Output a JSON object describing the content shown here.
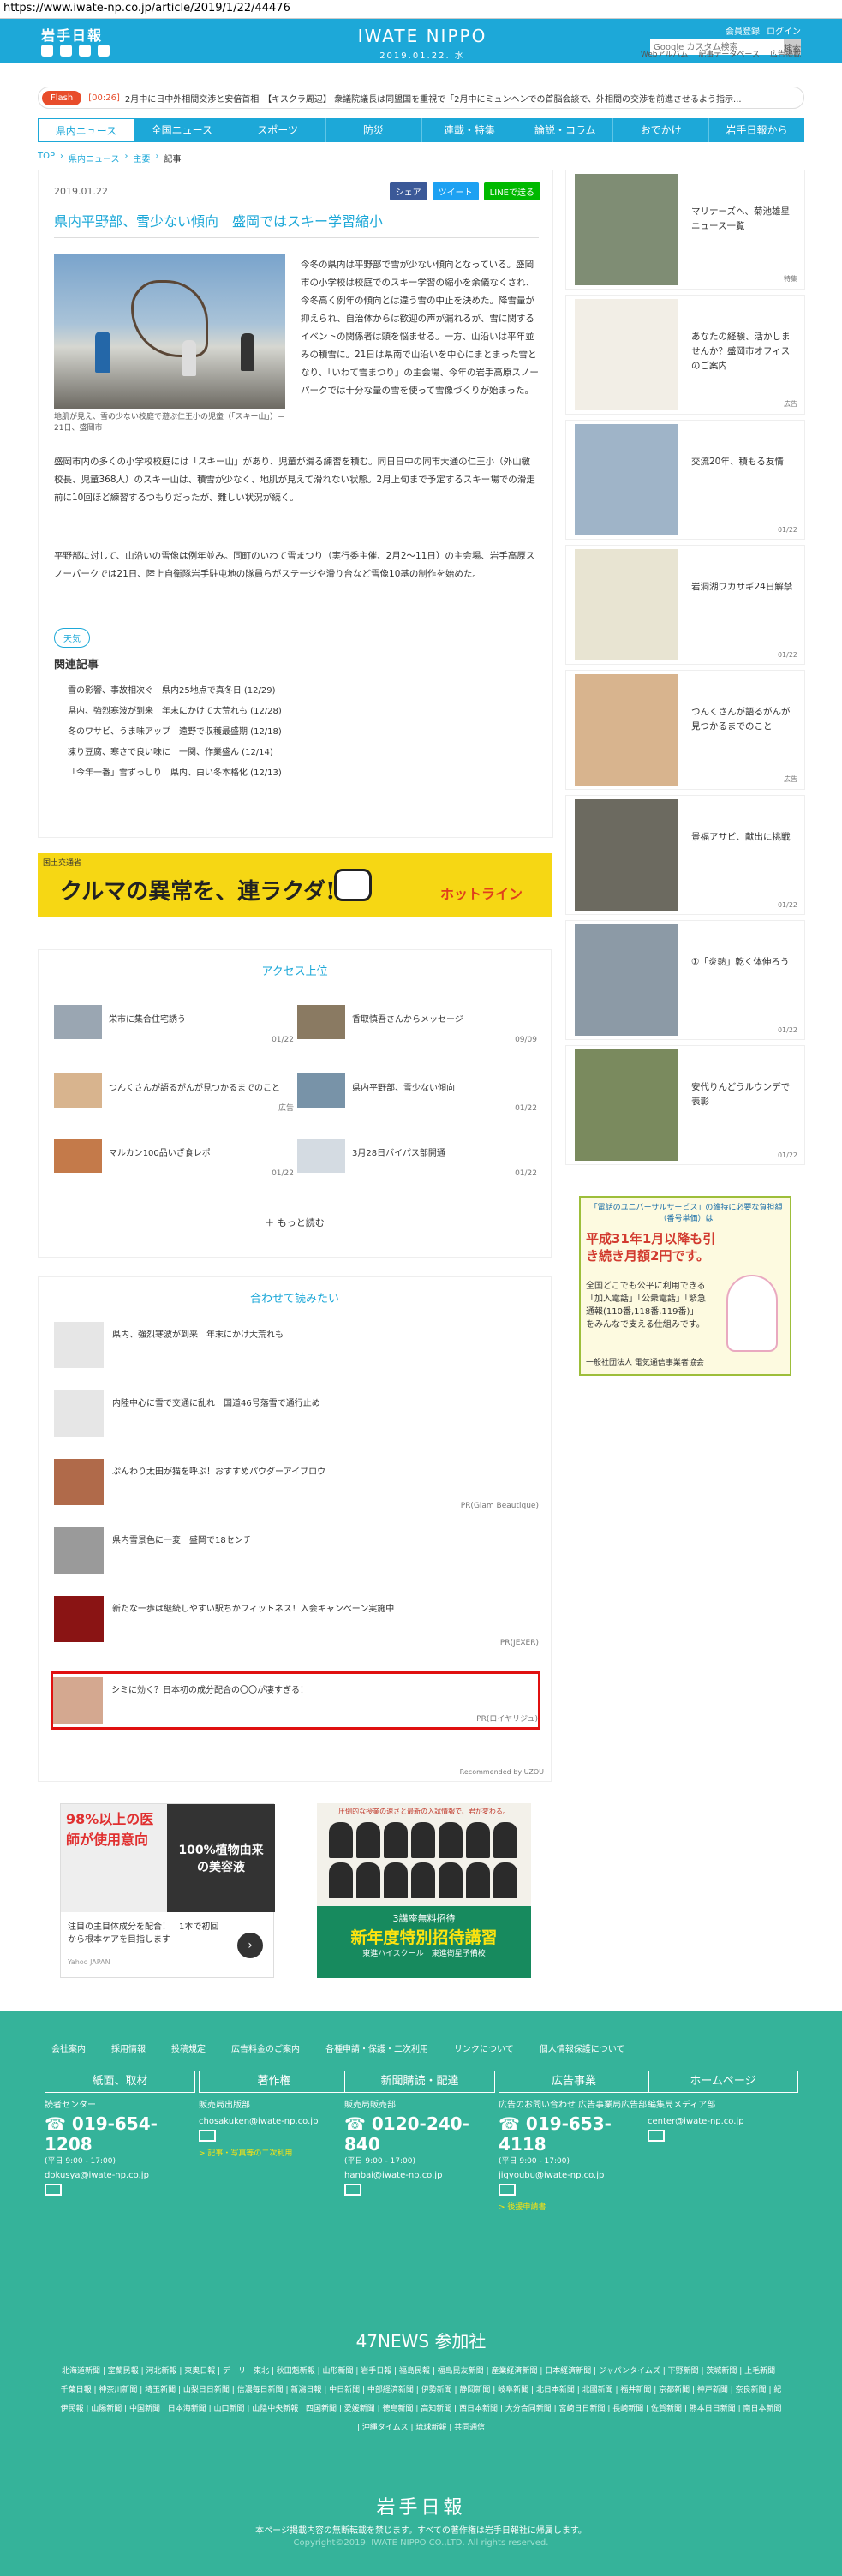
{
  "browser": {
    "url": "https://www.iwate-np.co.jp/article/2019/1/22/44476"
  },
  "header": {
    "logo_small": "岩手日報",
    "brand_name": "IWATE NIPPO",
    "brand_date": "2019.01.22. 水",
    "register": "会員登録",
    "login": "ログイン",
    "search_placeholder": "Google カスタム検索",
    "search_button": "検索",
    "subnav": [
      "Webアルバム",
      "記事データベース",
      "広告掲載"
    ]
  },
  "flash": {
    "tag": "Flash",
    "time": "[00:26]",
    "text": "2月中に日中外相間交渉と安倍首相　【キスクラ周辺】 衆議院議長は同盟国を重視で「2月中にミュンヘンでの首脳会談で、外相間の交渉を前進させるよう指示..."
  },
  "gnav": [
    "県内ニュース",
    "全国ニュース",
    "スポーツ",
    "防災",
    "連載・特集",
    "論説・コラム",
    "おでかけ",
    "岩手日報から"
  ],
  "breadcrumb": [
    "TOP",
    "県内ニュース",
    "主要",
    "記事"
  ],
  "article": {
    "date": "2019.01.22",
    "share": [
      "シェア",
      "ツイート",
      "LINEで送る"
    ],
    "title": "県内平野部、雪少ない傾向　盛岡ではスキー学習縮小",
    "caption": "地肌が見え、雪の少ない校庭で遊ぶ仁王小の児童（「スキー山」）＝21日、盛岡市",
    "p1": "今冬の県内は平野部で雪が少ない傾向となっている。盛岡市の小学校は校庭でのスキー学習の縮小を余儀なくされ、今冬高く例年の傾向とは違う雪の中止を決めた。降雪量が抑えられ、自治体からは歓迎の声が漏れるが、雪に関するイベントの関係者は頭を悩ませる。一方、山沿いは平年並みの積雪に。21日は県南で山沿いを中心にまとまった雪となり、「いわて雪まつり」の主会場、今年の岩手高原スノーパークでは十分な量の雪を使って雪像づくりが始まった。",
    "p2": "盛岡市内の多くの小学校校庭には「スキー山」があり、児童が滑る練習を積む。同日日中の同市大通の仁王小（外山敏校長、児童368人）のスキー山は、積雪が少なく、地肌が見えて滑れない状態。2月上旬まで予定するスキー場での滑走前に10回ほど練習するつもりだったが、難しい状況が続く。",
    "p3": "平野部に対して、山沿いの雪像は例年並み。同町のいわて雪まつり（実行委主催、2月2〜11日）の主会場、岩手高原スノーパークでは21日、陸上自衛隊岩手駐屯地の隊員らがステージや滑り台など雪像10基の制作を始めた。",
    "weather_tag": "天気",
    "related_heading": "関連記事",
    "related": [
      "雪の影響、事故相次ぐ　県内25地点で真冬日 (12/29)",
      "県内、強烈寒波が到来　年末にかけて大荒れも (12/28)",
      "冬のワサビ、うま味アップ　遠野で収穫最盛期 (12/18)",
      "凍り豆腐、寒さで良い味に　一関、作業盛ん (12/14)",
      "「今年一番」雪ずっしり　県内、白い冬本格化 (12/13)"
    ]
  },
  "banner_ad": {
    "small": "国土交通省",
    "main": "クルマの異常を、連ラクダ!",
    "brand": "ホットライン"
  },
  "ranking": {
    "heading": "アクセス上位",
    "items": [
      {
        "title": "栄市に集合住宅誘う",
        "date": "01/22"
      },
      {
        "title": "香取慎吾さんからメッセージ",
        "date": "09/09"
      },
      {
        "title": "つんくさんが語るがんが見つかるまでのこと",
        "date": "広告"
      },
      {
        "title": "県内平野部、雪少ない傾向",
        "date": "01/22"
      },
      {
        "title": "マルカン100品いざ食レポ",
        "date": "01/22"
      },
      {
        "title": "3月28日バイパス部開通",
        "date": "01/22"
      }
    ],
    "more": "もっと読む"
  },
  "recommend": {
    "heading": "合わせて読みたい",
    "items": [
      {
        "title": "県内、強烈寒波が到来　年末にかけ大荒れも",
        "pr": ""
      },
      {
        "title": "内陸中心に雪で交通に乱れ　国道46号落雪で通行止め",
        "pr": ""
      },
      {
        "title": "ぷんわり太田が猫を呼ぶ！おすすめパウダーアイブロウ",
        "pr": "PR(Glam Beautique)"
      },
      {
        "title": "県内雪景色に一変　盛岡で18センチ",
        "pr": ""
      },
      {
        "title": "新たな一歩は継続しやすい駅ちかフィットネス！入会キャンペーン実施中",
        "pr": "PR(JEXER)"
      },
      {
        "title": "シミに効く？日本初の成分配合の〇〇が凄すぎる！",
        "pr": "PR(ロイヤリジュ)"
      }
    ],
    "recommended_by": "Recommended by UZOU"
  },
  "ad_left": {
    "percent": "98%以上の医師が使用意向",
    "right": "100%植物由来の美容液",
    "text": "注目の主目体成分を配合！　1本で初回から根本ケアを目指します",
    "sponsor": "Yahoo JAPAN"
  },
  "ad_right": {
    "caption": "圧倒的な授業の速さと最新の入試情報で、君が変わる。",
    "line1": "3講座無料招待",
    "line2": "新年度特別招待講習",
    "line3": "東進ハイスクール　東進衛星予備校"
  },
  "sidebar": [
    {
      "title": "マリナーズへ、菊池雄星ニュース一覧",
      "date": "特集"
    },
    {
      "title": "あなたの経験、活かしませんか？盛岡市オフィスのご案内",
      "date": "広告"
    },
    {
      "title": "交流20年、積もる友情",
      "date": "01/22"
    },
    {
      "title": "岩洞湖ワカサギ24日解禁",
      "date": "01/22"
    },
    {
      "title": "つんくさんが語るがんが見つかるまでのこと",
      "date": "広告"
    },
    {
      "title": "景福アサビ、献出に挑戦",
      "date": "01/22"
    },
    {
      "title": "①「炎熱」乾く体伸ろう",
      "date": "01/22"
    },
    {
      "title": "安代りんどうルウンデで表彰",
      "date": "01/22"
    }
  ],
  "side_ad": {
    "l1": "「電話のユニバーサルサービス」の維持に必要な負担額（番号単価）は",
    "l2": "平成31年1月以降も引き続き月額2円です。",
    "l3": "全国どこでも公平に利用できる「加入電話」「公衆電話」「緊急通報(110番,118番,119番)」をみんなで支える仕組みです。",
    "l4": "一般社団法人 電気通信事業者協会"
  },
  "footer": {
    "links": [
      "会社案内",
      "採用情報",
      "投稿規定",
      "広告料金のご案内",
      "各種申請・保護・二次利用",
      "リンクについて",
      "個人情報保護について"
    ],
    "cols": [
      {
        "head": "紙面、取材",
        "label": "読者センター",
        "tel": "019-654-1208",
        "hours": "(平日 9:00 - 17:00)",
        "mail": "dokusya@iwate-np.co.jp",
        "extra": ""
      },
      {
        "head": "著作権",
        "label": "販売局出版部",
        "tel": "",
        "hours": "",
        "mail": "chosakuken@iwate-np.co.jp",
        "extra": "> 記事・写真等の二次利用"
      },
      {
        "head": "新聞購読・配達",
        "label": "販売局販売部",
        "tel": "0120-240-840",
        "hours": "(平日 9:00 - 17:00)",
        "mail": "hanbai@iwate-np.co.jp",
        "extra": ""
      },
      {
        "head": "広告事業",
        "label": "広告のお問い合わせ 広告事業局広告部",
        "tel": "019-653-4118",
        "hours": "(平日 9:00 - 17:00)",
        "mail": "jigyoubu@iwate-np.co.jp",
        "extra": "> 後援申請書"
      },
      {
        "head": "ホームページ",
        "label": "編集局メディア部",
        "tel": "",
        "hours": "",
        "mail": "center@iwate-np.co.jp",
        "extra": ""
      }
    ],
    "title_47": "47NEWS 参加社",
    "papers": "北海道新聞 | 室蘭民報 | 河北新報 | 東奥日報 | デーリー東北 | 秋田魁新報 | 山形新聞 | 岩手日報 | 福島民報 | 福島民友新聞 | 産業経済新聞 | 日本経済新聞 | ジャパンタイムズ | 下野新聞 | 茨城新聞 | 上毛新聞 | 千葉日報 | 神奈川新聞 | 埼玉新聞 | 山梨日日新聞 | 信濃毎日新聞 | 新潟日報 | 中日新聞 | 中部経済新聞 | 伊勢新聞 | 静岡新聞 | 岐阜新聞 | 北日本新聞 | 北國新聞 | 福井新聞 | 京都新聞 | 神戸新聞 | 奈良新聞 | 紀伊民報 | 山陽新聞 | 中国新聞 | 日本海新聞 | 山口新聞 | 山陰中央新報 | 四国新聞 | 愛媛新聞 | 徳島新聞 | 高知新聞 | 西日本新聞 | 大分合同新聞 | 宮崎日日新聞 | 長崎新聞 | 佐賀新聞 | 熊本日日新聞 | 南日本新聞 | 沖縄タイムス | 琉球新報 | 共同通信",
    "logo": "岩手日報",
    "note": "本ページ掲載内容の無断転載を禁じます。すべての著作権は岩手日報社に帰属します。",
    "copyright": "Copyright©2019. IWATE NIPPO CO.,LTD. All rights reserved."
  }
}
